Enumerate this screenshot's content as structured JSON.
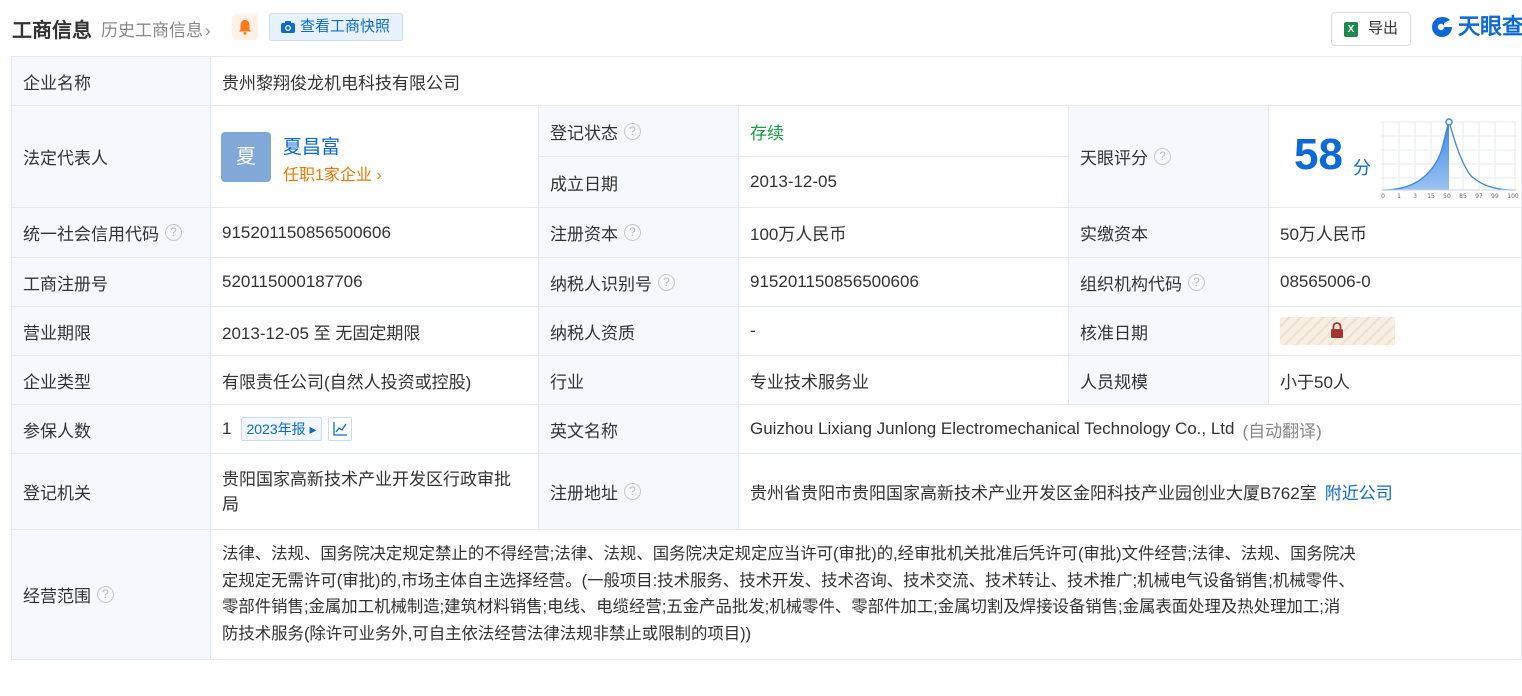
{
  "header": {
    "title": "工商信息",
    "history_link": "历史工商信息",
    "snapshot_button": "查看工商快照",
    "export_button": "导出",
    "export_icon_text": "X",
    "brand": "天眼查"
  },
  "rows": {
    "company_name": {
      "label": "企业名称",
      "value": "贵州黎翔俊龙机电科技有限公司"
    },
    "legal_rep": {
      "label": "法定代表人",
      "avatar_char": "夏",
      "name": "夏昌富",
      "sub": "任职1家企业",
      "reg_status_label": "登记状态",
      "reg_status_value": "存续",
      "found_date_label": "成立日期",
      "found_date_value": "2013-12-05",
      "score_label": "天眼评分",
      "score_value": "58",
      "score_unit": "分",
      "score_axis": [
        "0",
        "1",
        "3",
        "15",
        "50",
        "85",
        "97",
        "99",
        "100"
      ]
    },
    "credit_code": {
      "label": "统一社会信用代码",
      "value": "915201150856500606",
      "capital_label": "注册资本",
      "capital_value": "100万人民币",
      "paid_label": "实缴资本",
      "paid_value": "50万人民币"
    },
    "reg_no": {
      "label": "工商注册号",
      "value": "520115000187706",
      "taxpayer_id_label": "纳税人识别号",
      "taxpayer_id_value": "915201150856500606",
      "org_code_label": "组织机构代码",
      "org_code_value": "08565006-0"
    },
    "term": {
      "label": "营业期限",
      "value": "2013-12-05 至 无固定期限",
      "tax_qual_label": "纳税人资质",
      "tax_qual_value": "-",
      "approve_label": "核准日期"
    },
    "type": {
      "label": "企业类型",
      "value": "有限责任公司(自然人投资或控股)",
      "industry_label": "行业",
      "industry_value": "专业技术服务业",
      "staff_label": "人员规模",
      "staff_value": "小于50人"
    },
    "insured": {
      "label": "参保人数",
      "value": "1",
      "report_tag": "2023年报",
      "en_name_label": "英文名称",
      "en_name_value": "Guizhou Lixiang Junlong Electromechanical Technology Co., Ltd",
      "auto_translate": "(自动翻译)"
    },
    "authority": {
      "label": "登记机关",
      "value_line1": "贵阳国家高新技术产业开发区行政审批",
      "value_line2": "局",
      "address_label": "注册地址",
      "address_value": "贵州省贵阳市贵阳国家高新技术产业开发区金阳科技产业园创业大厦B762室",
      "nearby_link": "附近公司"
    },
    "scope": {
      "label": "经营范围",
      "line1": "法律、法规、国务院决定规定禁止的不得经营;法律、法规、国务院决定规定应当许可(审批)的,经审批机关批准后凭许可(审批)文件经营;法律、法规、国务院决",
      "line2": "定规定无需许可(审批)的,市场主体自主选择经营。(一般项目:技术服务、技术开发、技术咨询、技术交流、技术转让、技术推广;机械电气设备销售;机械零件、",
      "line3": "零部件销售;金属加工机械制造;建筑材料销售;电线、电缆经营;五金产品批发;机械零件、零部件加工;金属切割及焊接设备销售;金属表面处理及热处理加工;消",
      "line4": "防技术服务(除许可业务外,可自主依法经营法律法规非禁止或限制的项目))"
    }
  },
  "question_mark": "?",
  "colors": {
    "accent": "#0c6ad8",
    "status_green": "#14a33e",
    "orange": "#f07800",
    "label_bg": "#f5f8fd"
  }
}
